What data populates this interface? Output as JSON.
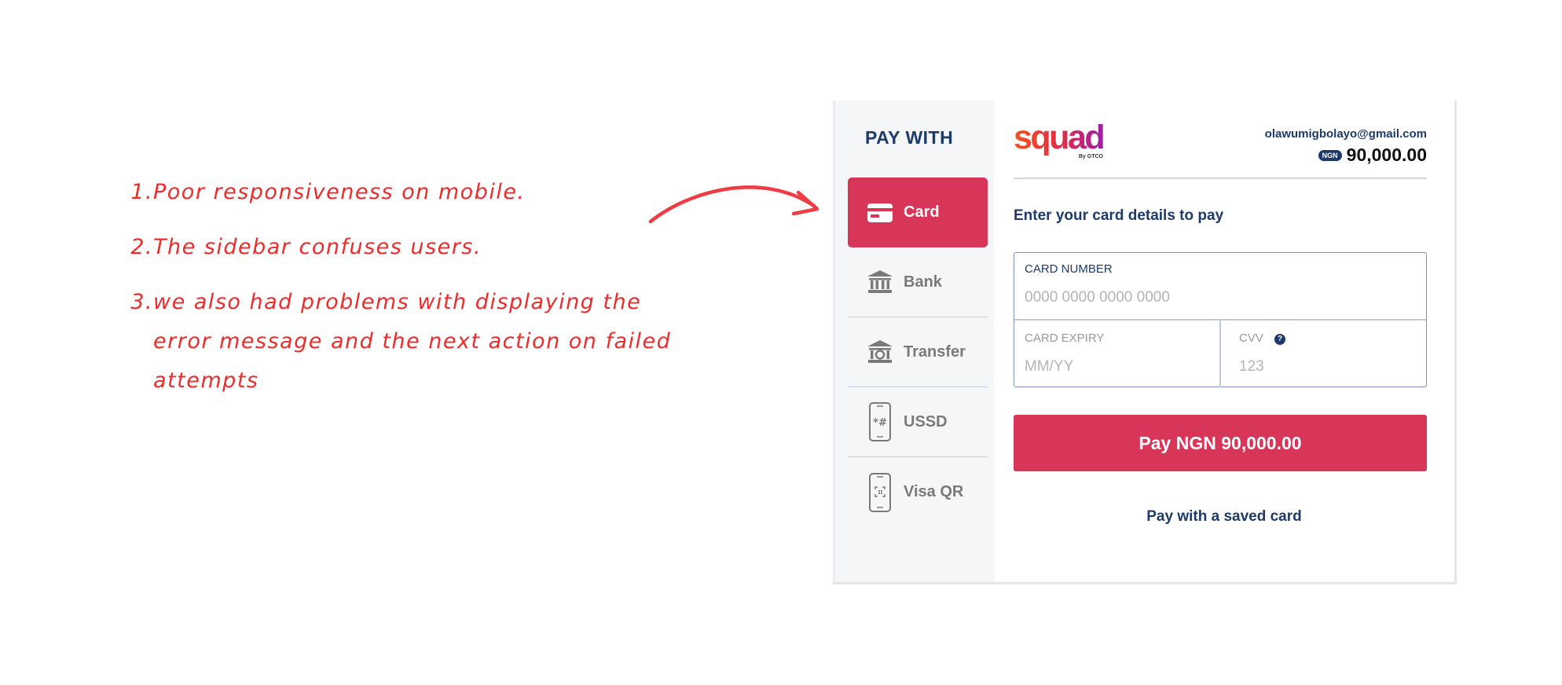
{
  "annotations": [
    {
      "num": "1.",
      "text": "Poor responsiveness on mobile."
    },
    {
      "num": "2.",
      "text": "The sidebar confuses users."
    },
    {
      "num": "3.",
      "text": " we also had problems with displaying the error message and the next action on failed attempts"
    }
  ],
  "sidebar": {
    "title": "PAY WITH",
    "methods": [
      {
        "label": "Card",
        "icon": "card-icon",
        "active": true
      },
      {
        "label": "Bank",
        "icon": "bank-icon"
      },
      {
        "label": "Transfer",
        "icon": "transfer-icon"
      },
      {
        "label": "USSD",
        "icon": "ussd-phone-icon"
      },
      {
        "label": "Visa QR",
        "icon": "qr-phone-icon"
      }
    ]
  },
  "header": {
    "brand": "squad",
    "brand_sub": "By GTCO",
    "email": "olawumigbolayo@gmail.com",
    "currency_badge": "NGN",
    "amount": "90,000.00"
  },
  "form": {
    "subtitle": "Enter your card details to pay",
    "card_number_label": "CARD NUMBER",
    "card_number_placeholder": "0000 0000 0000 0000",
    "expiry_label": "CARD EXPIRY",
    "expiry_placeholder": "MM/YY",
    "cvv_label": "CVV",
    "cvv_help": "?",
    "cvv_placeholder": "123",
    "pay_button": "Pay NGN 90,000.00",
    "saved_card_link": "Pay with a saved card"
  },
  "colors": {
    "accent": "#d83659",
    "navy": "#1e3a6a",
    "annotation_red": "#ee2b2b",
    "sidebar_bg": "#f4f6f7"
  }
}
